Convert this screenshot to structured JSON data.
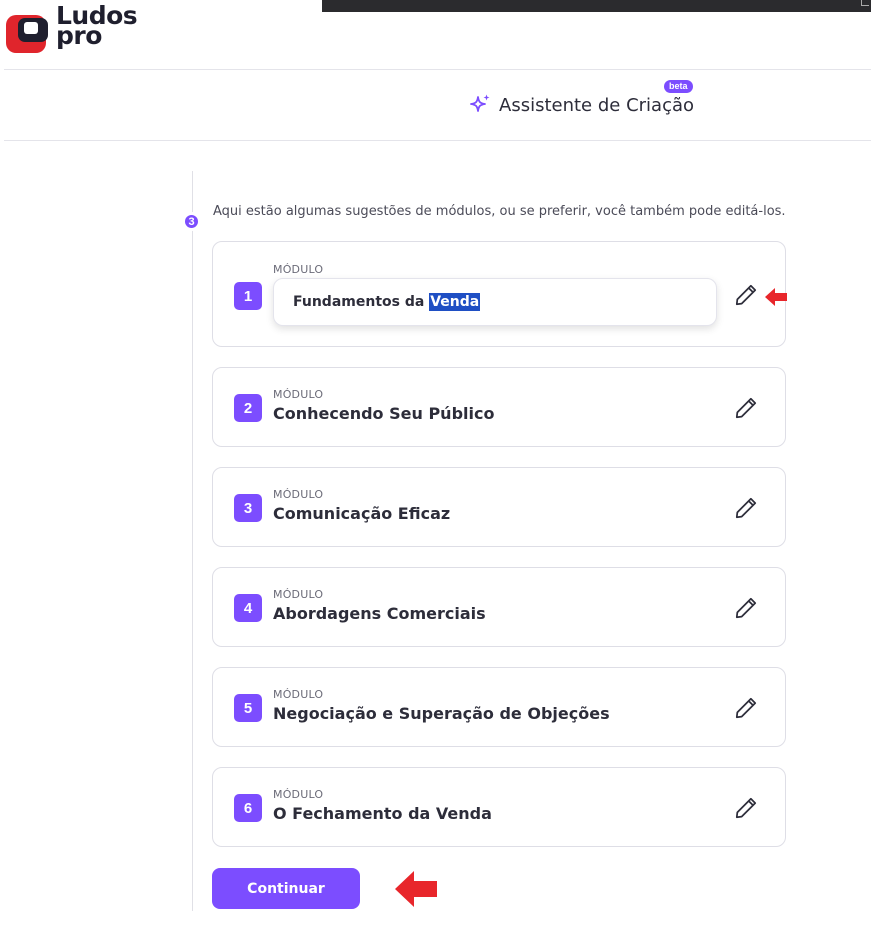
{
  "brand": {
    "logo_line1": "Ludos",
    "logo_line2": "pro"
  },
  "header": {
    "title": "Assistente de Criação",
    "badge": "beta",
    "icon": "sparkle-icon"
  },
  "step": {
    "number": "3",
    "instruction": "Aqui estão algumas sugestões de módulos, ou se preferir, você também pode editá-los."
  },
  "modules": [
    {
      "number": "1",
      "label": "MÓDULO",
      "title_before": "Fundamentos da ",
      "title_selected": "Venda",
      "editing": true
    },
    {
      "number": "2",
      "label": "MÓDULO",
      "title": "Conhecendo Seu Público"
    },
    {
      "number": "3",
      "label": "MÓDULO",
      "title": "Comunicação Eficaz"
    },
    {
      "number": "4",
      "label": "MÓDULO",
      "title": "Abordagens Comerciais"
    },
    {
      "number": "5",
      "label": "MÓDULO",
      "title": "Negociação e Superação de Objeções"
    },
    {
      "number": "6",
      "label": "MÓDULO",
      "title": "O Fechamento da Venda"
    }
  ],
  "actions": {
    "continue_label": "Continuar"
  },
  "colors": {
    "accent": "#7c4dff",
    "annotation_arrow": "#e8262b",
    "selection": "#1f4fc4"
  }
}
